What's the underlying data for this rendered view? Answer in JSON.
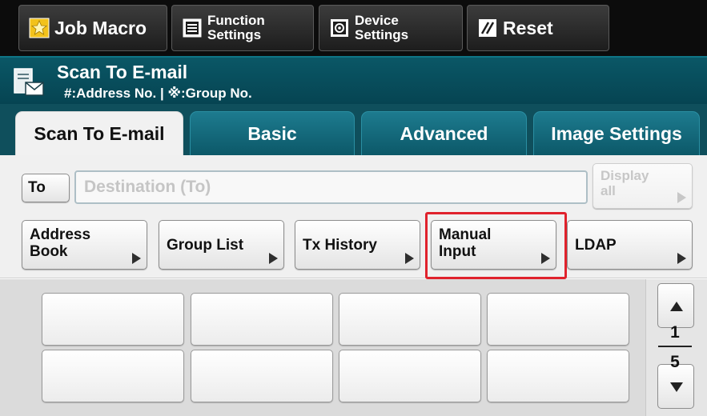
{
  "toolbar": {
    "job_macro": "Job Macro",
    "function_settings": [
      "Function",
      "Settings"
    ],
    "device_settings": [
      "Device",
      "Settings"
    ],
    "reset": "Reset",
    "icons": [
      "star-icon",
      "function-settings-icon",
      "device-settings-icon",
      "reset-icon"
    ]
  },
  "header": {
    "title": "Scan To E-mail",
    "subtitle": "#:Address No. | ※:Group No.",
    "icon": "scan-to-email-icon"
  },
  "tabs": [
    "Scan To E-mail",
    "Basic",
    "Advanced",
    "Image Settings"
  ],
  "active_tab": "Scan To E-mail",
  "destination": {
    "to_label": "To",
    "placeholder": "Destination (To)",
    "display_all": [
      "Display",
      "all"
    ]
  },
  "sources": {
    "address_book": [
      "Address",
      "Book"
    ],
    "group_list": "Group List",
    "tx_history": "Tx History",
    "manual_input": [
      "Manual",
      "Input"
    ],
    "ldap": "LDAP"
  },
  "highlighted_button": "Manual Input",
  "pager": {
    "current": "1",
    "total": "5"
  },
  "colors": {
    "highlight": "#e0222c",
    "header": "#064452",
    "tab": "#0c5868"
  }
}
